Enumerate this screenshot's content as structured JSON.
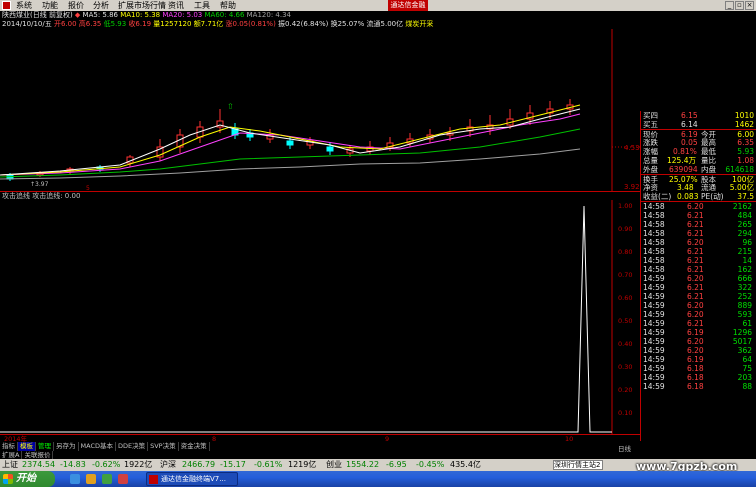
{
  "menubar": {
    "items": [
      "系统",
      "功能",
      "报价",
      "分析",
      "扩展市场行情",
      "资讯",
      "工具",
      "帮助"
    ],
    "brand": "通达信金融"
  },
  "header": {
    "title": "陕西煤业(日线 前复权)",
    "ma5": "MA5: 5.86",
    "ma10": "MA10: 5.38",
    "ma20": "MA20: 5.03",
    "ma60": "MA60: 4.66",
    "ma120": "MA120: 4.34",
    "info_date": "2014/10/10/五",
    "info_open": "开6.00",
    "info_high": "高6.35",
    "info_low": "低5.93",
    "info_close": "收6.19",
    "info_volume": "量1257120",
    "info_amount": "额7.71亿",
    "info_change": "涨0.05(0.81%)",
    "info_amp": "振0.42(6.84%)",
    "info_turnover": "换25.07%",
    "info_float": "流通5.00亿",
    "info_concept": "煤炭开采"
  },
  "main_chart": {
    "price_labels": [
      "4.53",
      "3.92"
    ],
    "low_marker": "↑3.97",
    "volume_marker": "5"
  },
  "sub_chart": {
    "title": "攻击追线 攻击追线: 0.00",
    "y_labels": [
      "1.00",
      "0.90",
      "0.80",
      "0.70",
      "0.60",
      "0.50",
      "0.40",
      "0.30",
      "0.20",
      "0.10"
    ],
    "x_labels": [
      "2014年",
      "8",
      "9",
      "10"
    ],
    "series": [
      {
        "x": "10",
        "value": 1.0
      }
    ]
  },
  "quote": {
    "buy1_label": "买四",
    "buy1_price": "6.15",
    "buy1_vol": "1010",
    "buy5_label": "买五",
    "buy5_price": "6.14",
    "buy5_vol": "1462",
    "now_label": "现价",
    "now_value": "6.19",
    "open_label": "今开",
    "open_value": "6.00",
    "chg_label": "涨跌",
    "chg_value": "0.05",
    "high_label": "最高",
    "high_value": "6.35",
    "pct_label": "涨幅",
    "pct_value": "0.81%",
    "low_label": "最低",
    "low_value": "5.93",
    "vol_label": "总量",
    "vol_value": "125.4万",
    "ratio_label": "量比",
    "ratio_value": "1.08",
    "outer_label": "外盘",
    "outer_value": "639094",
    "inner_label": "内盘",
    "inner_value": "614618",
    "turn_label": "换手",
    "turn_value": "25.07%",
    "cap_label": "股本",
    "cap_value": "100亿",
    "nav_label": "净资",
    "nav_value": "3.48",
    "flow_label": "流通",
    "flow_value": "5.00亿",
    "eps_label": "收益(二)",
    "eps_value": "0.083",
    "pe_label": "PE(动)",
    "pe_value": "37.5"
  },
  "ticks": [
    [
      "14:58",
      "6.20",
      "2162"
    ],
    [
      "14:58",
      "6.21",
      "484"
    ],
    [
      "14:58",
      "6.21",
      "265"
    ],
    [
      "14:58",
      "6.21",
      "294"
    ],
    [
      "14:58",
      "6.20",
      "96"
    ],
    [
      "14:58",
      "6.21",
      "215"
    ],
    [
      "14:58",
      "6.21",
      "14"
    ],
    [
      "14:58",
      "6.21",
      "162"
    ],
    [
      "14:59",
      "6.20",
      "666"
    ],
    [
      "14:59",
      "6.21",
      "322"
    ],
    [
      "14:59",
      "6.21",
      "252"
    ],
    [
      "14:59",
      "6.20",
      "889"
    ],
    [
      "14:59",
      "6.20",
      "593"
    ],
    [
      "14:59",
      "6.21",
      "61"
    ],
    [
      "14:59",
      "6.19",
      "1296"
    ],
    [
      "14:59",
      "6.20",
      "5017"
    ],
    [
      "14:59",
      "6.20",
      "362"
    ],
    [
      "14:59",
      "6.19",
      "64"
    ],
    [
      "14:59",
      "6.18",
      "75"
    ],
    [
      "14:59",
      "6.18",
      "203"
    ],
    [
      "14:59",
      "6.18",
      "88"
    ]
  ],
  "tabs": [
    "指标",
    "模板",
    "管理",
    "另存为",
    "MACD基本",
    "DDE决策",
    "SVP决策",
    "资金决策"
  ],
  "tabs2": [
    "扩展A",
    "关联报价"
  ],
  "right_tab": "日线",
  "status": {
    "sh_label": "上证",
    "sh_value": "2374.54",
    "sh_chg": "-14.83",
    "sh_pct": "-0.62%",
    "sh_amt": "1922亿",
    "sz_label": "沪深",
    "sz_value": "2466.79",
    "sz_chg": "-15.17",
    "sz_pct": "-0.61%",
    "sz_amt": "1219亿",
    "cy_label": "创业",
    "cy_value": "1554.22",
    "cy_chg": "-6.95",
    "cy_pct": "-0.45%",
    "cy_amt": "435.4亿",
    "server": "深圳行情主站2"
  },
  "watermark": "www.7gpzb.com",
  "taskbar": {
    "start": "开始",
    "task": "通达信金融终端V7..."
  },
  "colors": {
    "up": "#ff3232",
    "down": "#00ffff",
    "border": "#c00000"
  }
}
